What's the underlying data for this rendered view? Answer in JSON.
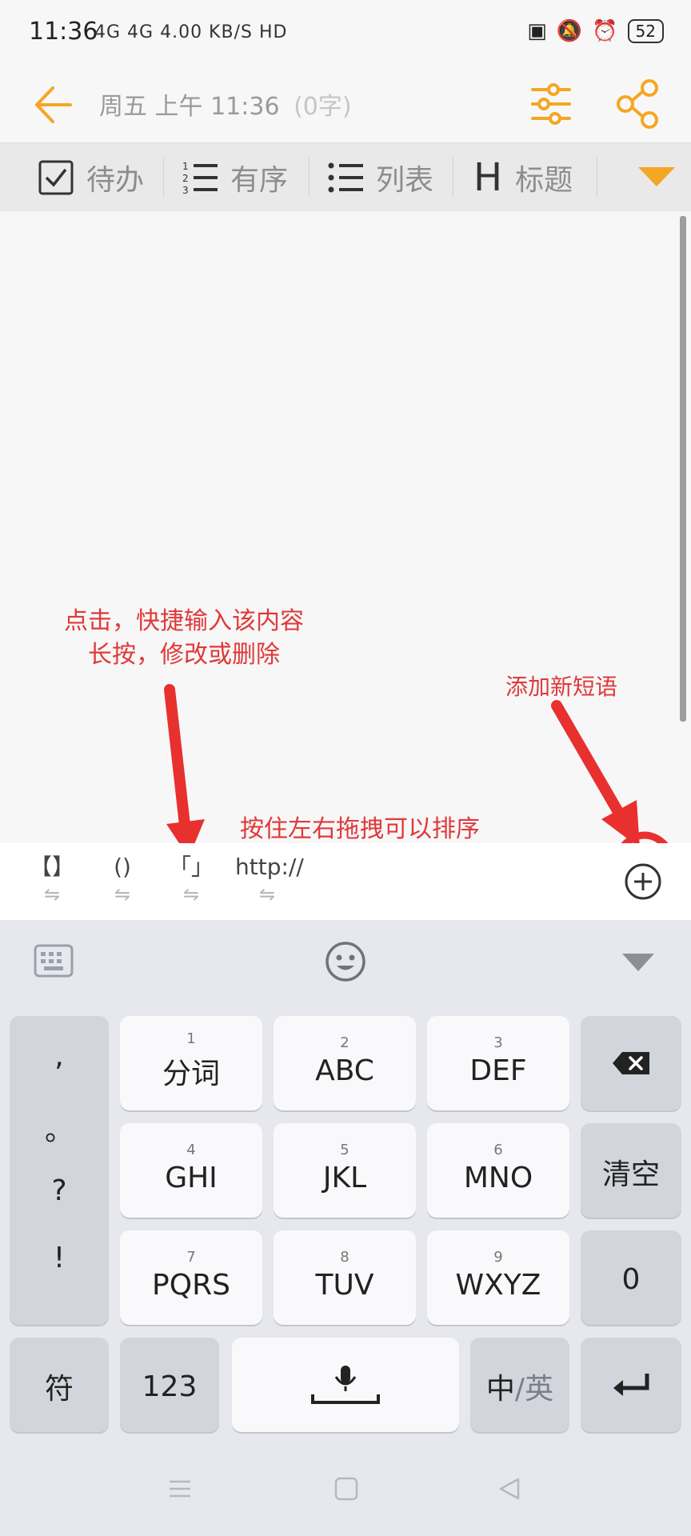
{
  "status_bar": {
    "time": "11:36",
    "network": "4G 4G 4.00 KB/S HD",
    "battery": "52"
  },
  "title_bar": {
    "title": "周五 上午 11:36",
    "word_count": "(0字)"
  },
  "toolbar": {
    "todo": "待办",
    "ordered": "有序",
    "list": "列表",
    "heading_letter": "H",
    "heading": "标题"
  },
  "phrases": [
    {
      "text": "【】",
      "handle": "⇋"
    },
    {
      "text": "()",
      "handle": "⇋"
    },
    {
      "text": "「」",
      "handle": "⇋"
    },
    {
      "text": "http://",
      "handle": "⇋"
    }
  ],
  "keyboard": {
    "punctuation": [
      ",",
      "。",
      "?",
      "!"
    ],
    "keys": [
      {
        "num": "1",
        "label": "分词"
      },
      {
        "num": "2",
        "label": "ABC"
      },
      {
        "num": "3",
        "label": "DEF"
      },
      {
        "num": "4",
        "label": "GHI"
      },
      {
        "num": "5",
        "label": "JKL"
      },
      {
        "num": "6",
        "label": "MNO"
      },
      {
        "num": "7",
        "label": "PQRS"
      },
      {
        "num": "8",
        "label": "TUV"
      },
      {
        "num": "9",
        "label": "WXYZ"
      }
    ],
    "clear": "清空",
    "zero": "0",
    "symbols": "符",
    "numbers": "123",
    "lang_zh": "中",
    "lang_sep": "/",
    "lang_en": "英"
  },
  "annotations": {
    "tap_line1": "点击，快捷输入该内容",
    "tap_line2": "长按，修改或删除",
    "add_phrase": "添加新短语",
    "drag_sort": "按住左右拖拽可以排序"
  },
  "colors": {
    "accent": "#f5a623",
    "annotation": "#e0393a"
  }
}
